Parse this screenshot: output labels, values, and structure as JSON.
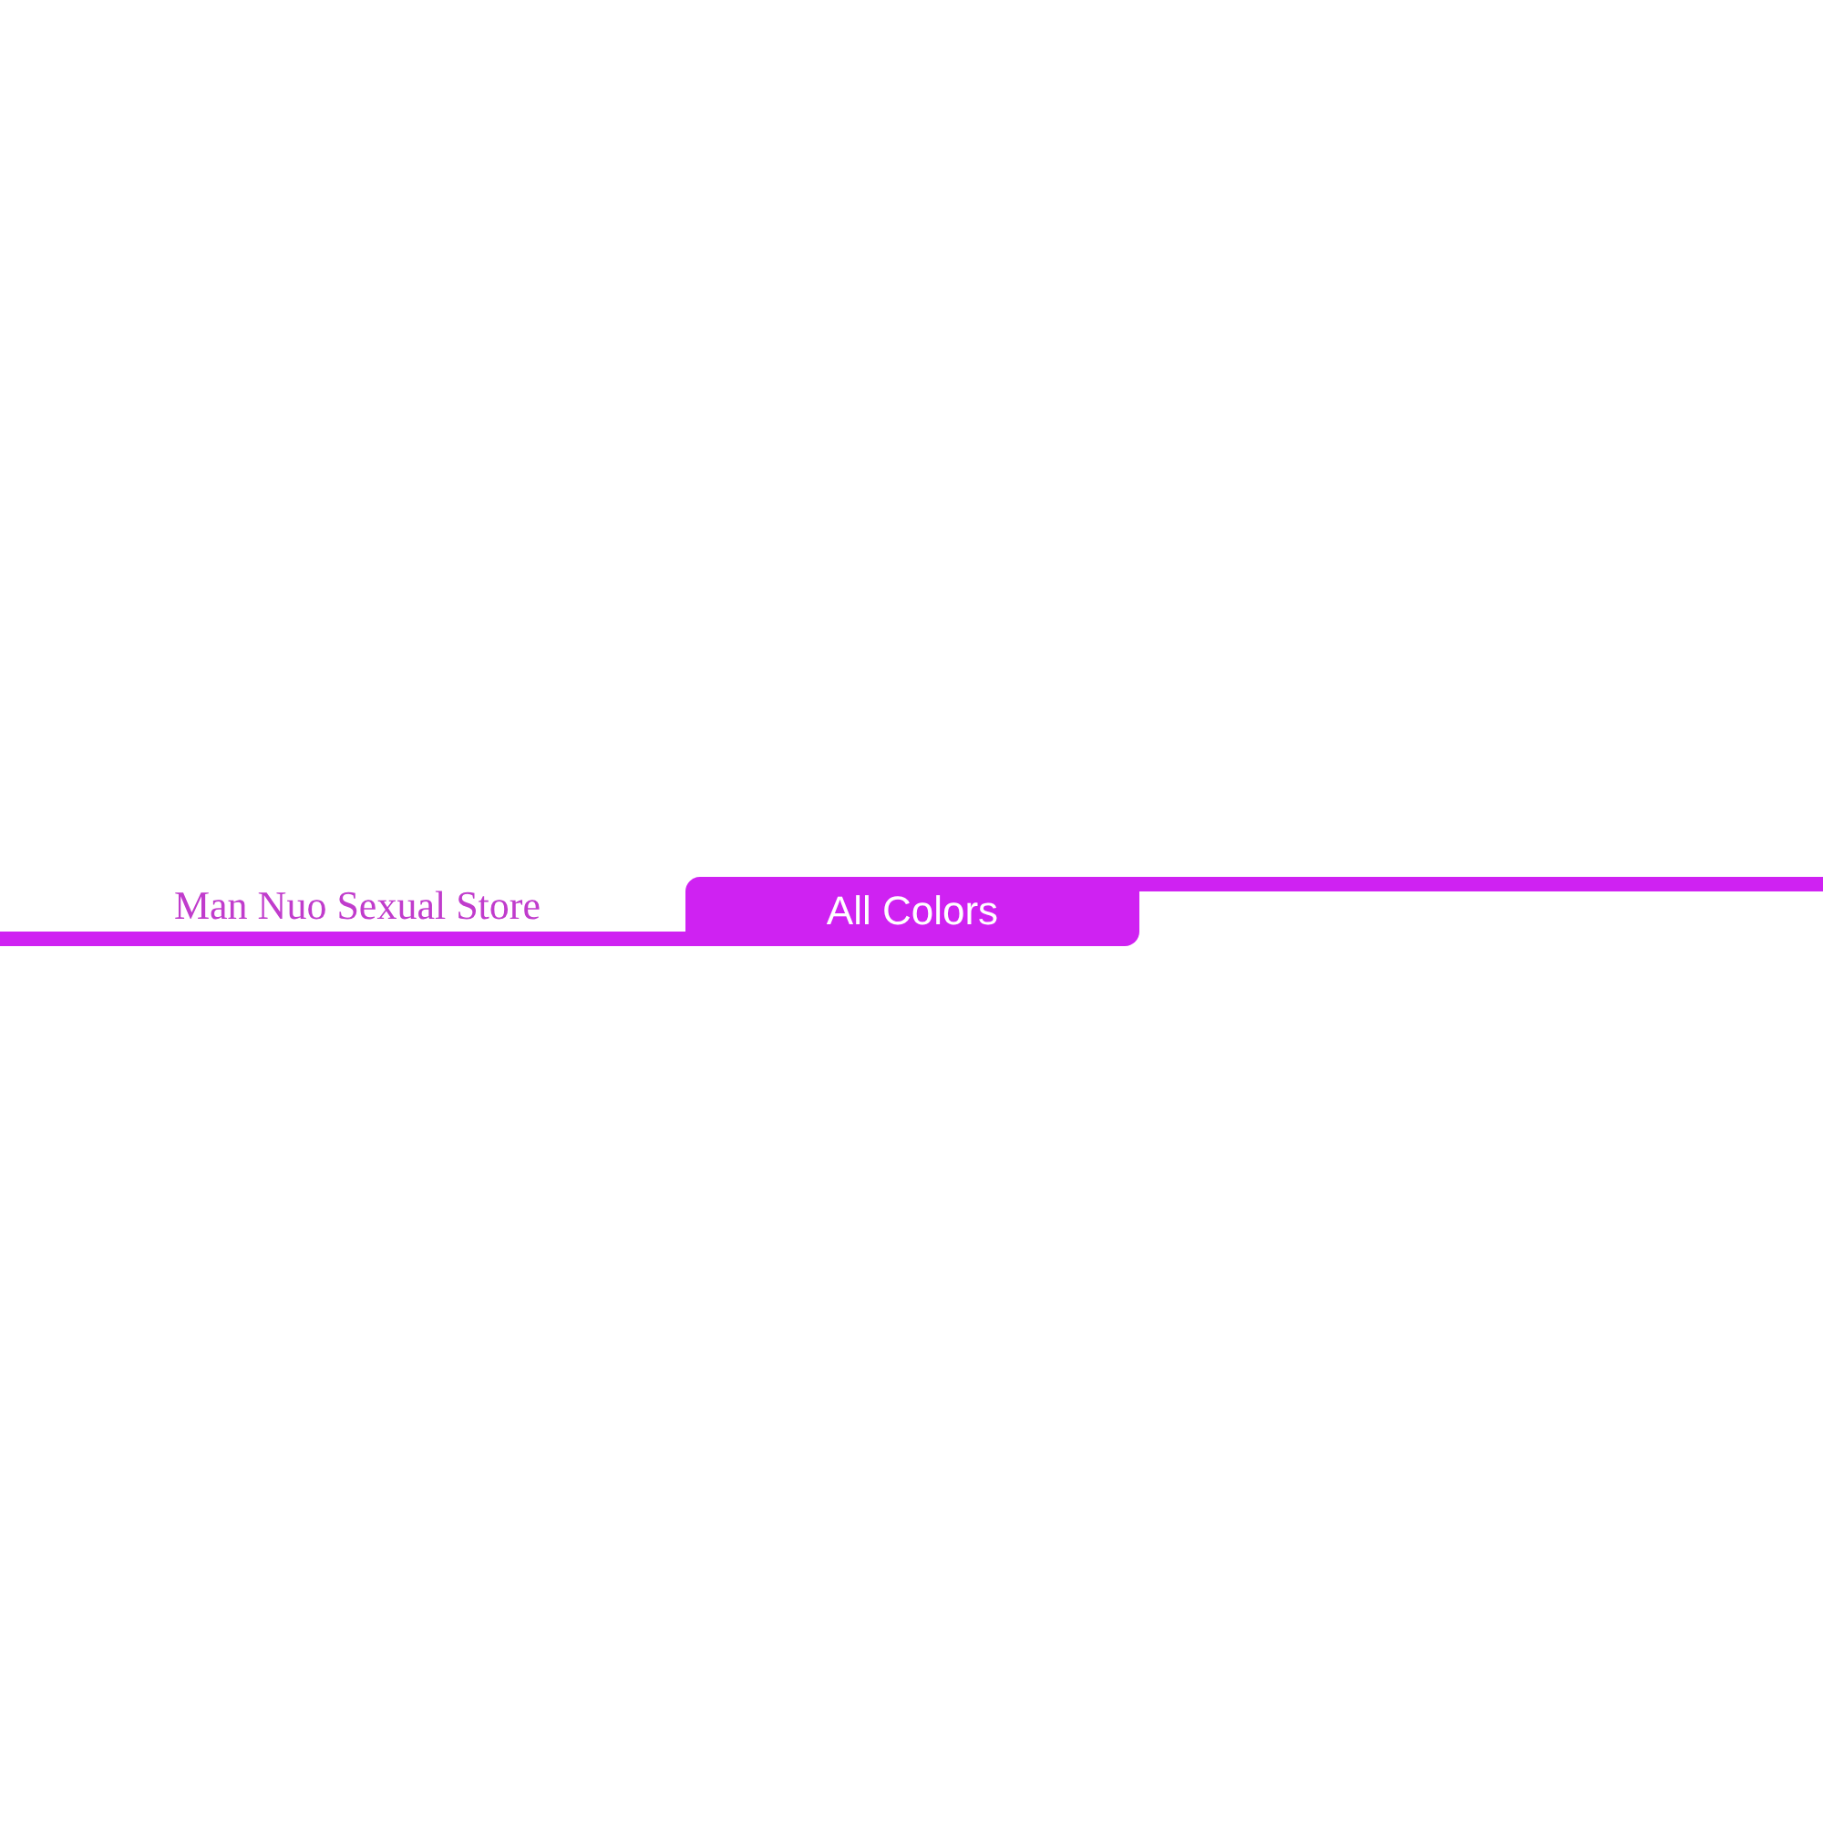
{
  "store_name": "Man Nuo Sexual Store",
  "section_tab": {
    "label": "All Colors"
  }
}
